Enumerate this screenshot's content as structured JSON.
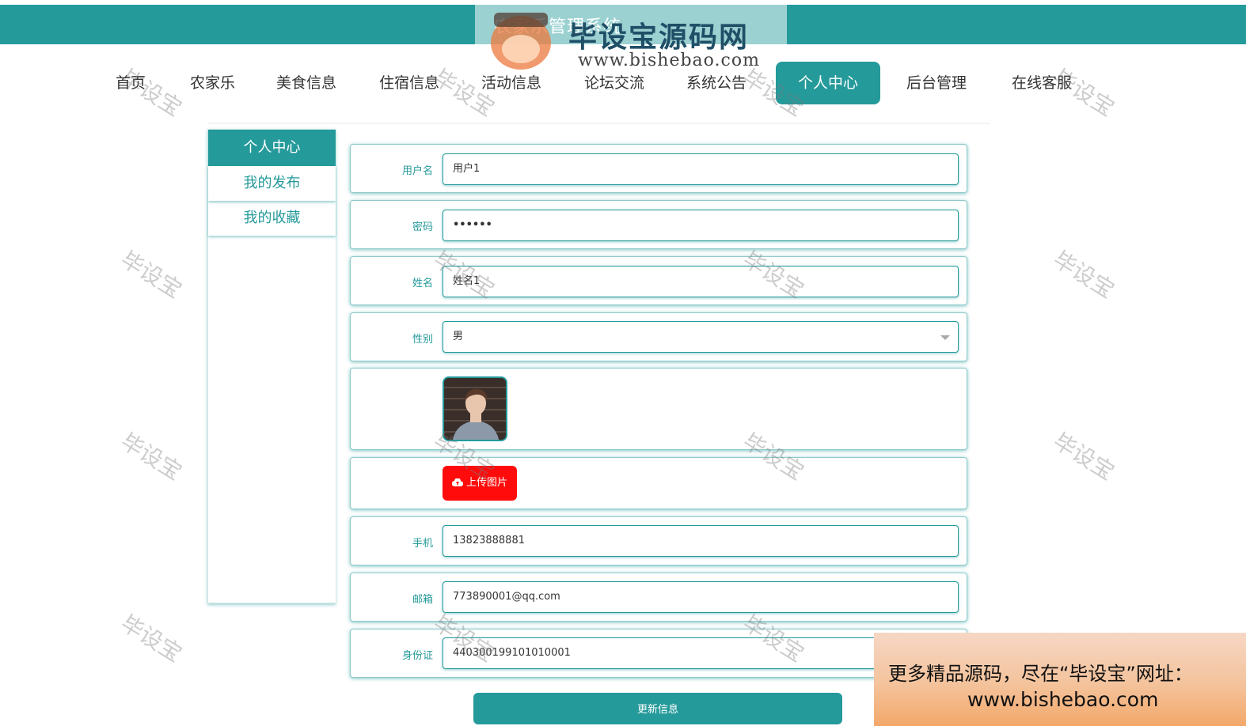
{
  "header": {
    "title": "农家乐管理系统"
  },
  "nav": {
    "items": [
      "首页",
      "农家乐",
      "美食信息",
      "住宿信息",
      "活动信息",
      "论坛交流",
      "系统公告",
      "个人中心",
      "后台管理",
      "在线客服"
    ],
    "active": "个人中心"
  },
  "sidebar": {
    "title": "个人中心",
    "items": [
      "我的发布",
      "我的收藏"
    ]
  },
  "form": {
    "username_label": "用户名",
    "username": "用户1",
    "password_label": "密码",
    "password": "••••••",
    "name_label": "姓名",
    "name": "姓名1",
    "gender_label": "性别",
    "gender": "男",
    "upload_label": "上传图片",
    "phone_label": "手机",
    "phone": "13823888881",
    "email_label": "邮箱",
    "email": "773890001@qq.com",
    "idcard_label": "身份证",
    "idcard": "440300199101010001",
    "submit_label": "更新信息"
  },
  "watermarks": {
    "text": "毕设宝",
    "logo_text": "毕设宝源码网",
    "logo_url": "www.bishebao.com",
    "promo_line1": "更多精品源码，尽在“毕设宝”网址：",
    "promo_line2": "www.bishebao.com"
  },
  "colors": {
    "primary": "#259a9b",
    "upload": "#ff0b0b"
  }
}
